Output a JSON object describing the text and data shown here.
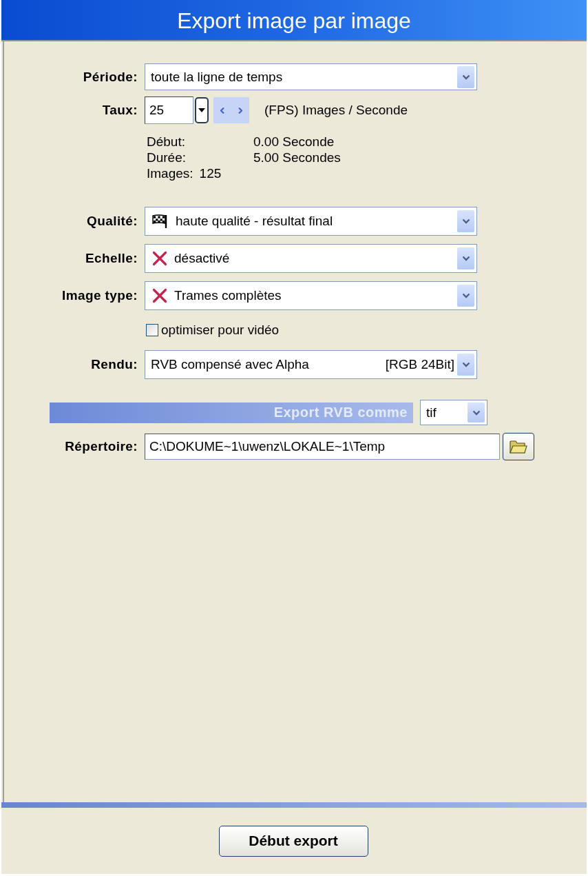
{
  "window": {
    "title": "Export image par image"
  },
  "form": [
    {
      "kind": "dropdown",
      "label": "Période:",
      "value": "toute la ligne de temps"
    },
    {
      "kind": "rate",
      "label": "Taux:",
      "value": "25",
      "unit": "(FPS) Images / Seconde"
    },
    {
      "kind": "info",
      "lines": [
        {
          "kind": "column",
          "label": "Début:",
          "value": "0.00 Seconde"
        },
        {
          "kind": "column",
          "label": "Durée:",
          "value": "5.00 Secondes"
        },
        {
          "kind": "inline",
          "label": "Images:",
          "value": "125"
        }
      ]
    },
    {
      "kind": "flagged",
      "label": "Qualité:",
      "value": "haute qualité - résultat final"
    },
    {
      "kind": "crossed",
      "label": "Echelle:",
      "value": "désactivé"
    },
    {
      "kind": "crossed",
      "label": "Image type:",
      "value": "Trames complètes"
    },
    {
      "kind": "checkbox",
      "label": "optimiser pour vidéo",
      "checked": false
    },
    {
      "kind": "dropdown",
      "label": "Rendu:",
      "value": "RVB compensé avec Alpha",
      "detail": "[RGB 24Bit]"
    },
    {
      "kind": "format",
      "label": "Export RVB comme",
      "value": "tif"
    },
    {
      "kind": "folder",
      "label": "Répertoire:",
      "value": "C:\\DOKUME~1\\uwenz\\LOKALE~1\\Temp"
    }
  ],
  "start_button": {
    "label": "Début export"
  }
}
